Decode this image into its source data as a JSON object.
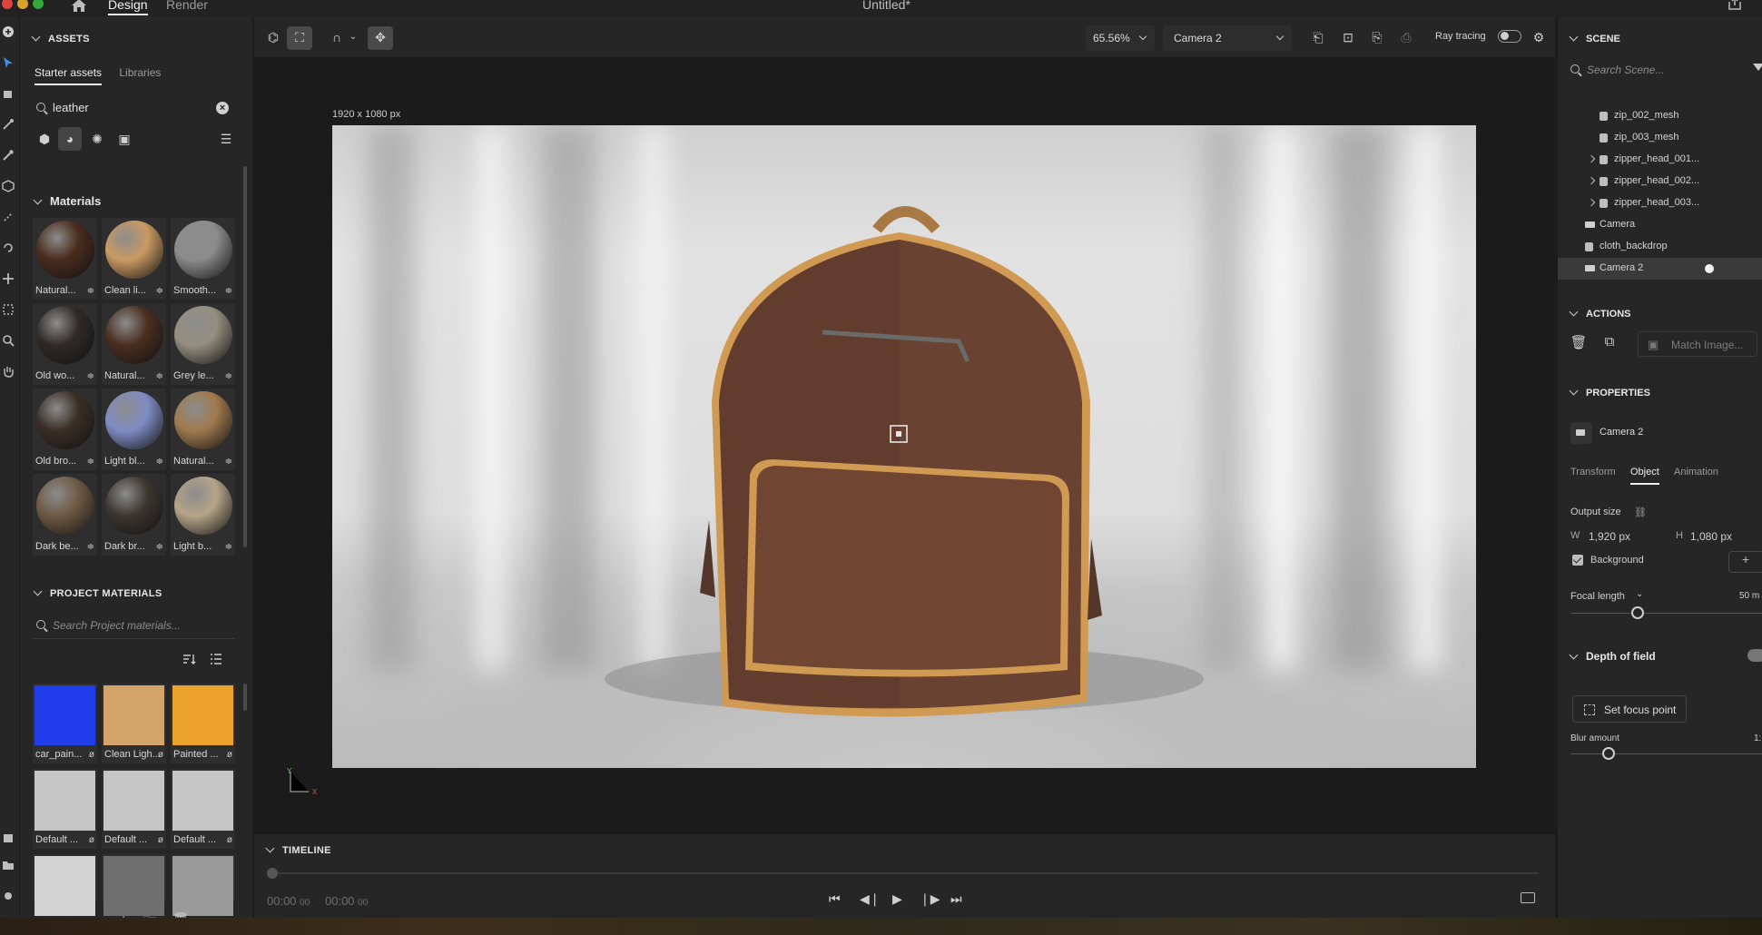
{
  "topbar": {
    "tabs": [
      "Design",
      "Render"
    ],
    "document_title": "Untitled*"
  },
  "assets": {
    "header": "ASSETS",
    "tabs": [
      "Starter assets",
      "Libraries"
    ],
    "search_value": "leather",
    "materials_header": "Materials",
    "materials": [
      {
        "label": "Natural...",
        "color": "#4a2c1e"
      },
      {
        "label": "Clean li...",
        "color": "#c99a62"
      },
      {
        "label": "Smooth...",
        "color": "#8c8c8c"
      },
      {
        "label": "Old wo...",
        "color": "#2f2a26"
      },
      {
        "label": "Natural...",
        "color": "#4a2e20"
      },
      {
        "label": "Grey le...",
        "color": "#958f80"
      },
      {
        "label": "Old bro...",
        "color": "#3a2e26"
      },
      {
        "label": "Light bl...",
        "color": "#7f8cc2"
      },
      {
        "label": "Natural...",
        "color": "#a07a4e"
      },
      {
        "label": "Dark be...",
        "color": "#6e5a44"
      },
      {
        "label": "Dark br...",
        "color": "#3c3630"
      },
      {
        "label": "Light b...",
        "color": "#b4a488"
      }
    ],
    "project_header": "PROJECT MATERIALS",
    "project_search_placeholder": "Search Project materials...",
    "project_materials": [
      {
        "label": "car_pain...",
        "color": "#1f3de8"
      },
      {
        "label": "Clean Ligh...",
        "color": "#d4a56a"
      },
      {
        "label": "Painted ...",
        "color": "#eba12c"
      },
      {
        "label": "Default ...",
        "color": "#c6c6c6"
      },
      {
        "label": "Default ...",
        "color": "#c6c6c6"
      },
      {
        "label": "Default ...",
        "color": "#c6c6c6"
      },
      {
        "label": "",
        "color": "#d2d2d2"
      },
      {
        "label": "",
        "color": "#6f6f6f"
      },
      {
        "label": "",
        "color": "#9a9a9a"
      }
    ]
  },
  "viewport": {
    "zoom": "65.56%",
    "camera": "Camera 2",
    "ray_tracing_label": "Ray tracing",
    "canvas_size": "1920 x 1080 px",
    "axis_y": "Y",
    "axis_x": "X"
  },
  "timeline": {
    "header": "TIMELINE",
    "time_current": "00:00",
    "time_current_frames": "00",
    "time_total": "00:00",
    "time_total_frames": "00"
  },
  "scene": {
    "header": "SCENE",
    "search_placeholder": "Search Scene...",
    "items": [
      {
        "label": "zip_002_mesh",
        "type": "mesh"
      },
      {
        "label": "zip_003_mesh",
        "type": "mesh"
      },
      {
        "label": "zipper_head_001...",
        "type": "group"
      },
      {
        "label": "zipper_head_002...",
        "type": "group"
      },
      {
        "label": "zipper_head_003...",
        "type": "group"
      },
      {
        "label": "Camera",
        "type": "camera"
      },
      {
        "label": "cloth_backdrop",
        "type": "mesh"
      },
      {
        "label": "Camera 2",
        "type": "camera"
      }
    ]
  },
  "actions": {
    "header": "ACTIONS",
    "match_image": "Match Image..."
  },
  "properties": {
    "header": "PROPERTIES",
    "object_name": "Camera 2",
    "tabs": [
      "Transform",
      "Object",
      "Animation"
    ],
    "output_size_label": "Output size",
    "width_label": "W",
    "width_value": "1,920 px",
    "height_label": "H",
    "height_value": "1,080 px",
    "background_label": "Background",
    "focal_length_label": "Focal length",
    "focal_length_value": "50 m",
    "focal_length_slider": 0.35,
    "dof_label": "Depth of field",
    "set_focus_label": "Set focus point",
    "blur_amount_label": "Blur amount",
    "blur_amount_value": "1:",
    "blur_amount_slider": 0.2
  }
}
